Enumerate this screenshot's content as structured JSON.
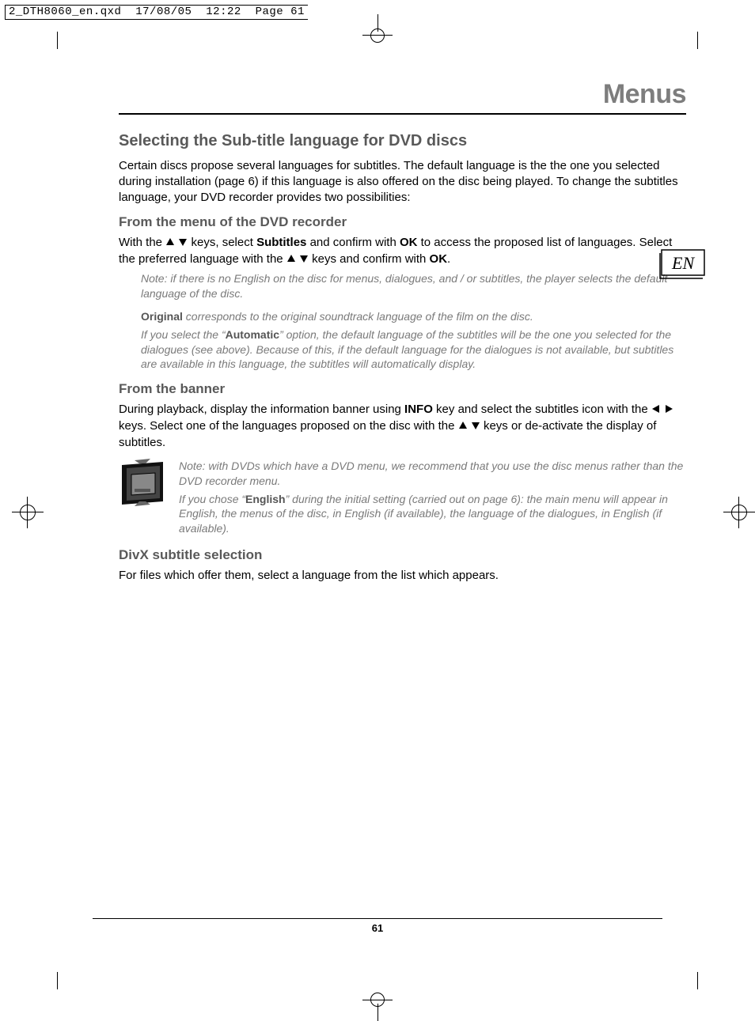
{
  "prepress": {
    "filename": "2_DTH8060_en.qxd",
    "date": "17/08/05",
    "time": "12:22",
    "page_label": "Page 61"
  },
  "chapter_title": "Menus",
  "language_badge": "EN",
  "sections": {
    "s1": {
      "title": "Selecting the Sub-title language for DVD discs",
      "p1": "Certain discs propose several languages for subtitles. The default language is the the one you selected during installation (page 6) if this language is also offered on the disc being played. To change the subtitles language, your DVD recorder provides two possibilities:"
    },
    "s2": {
      "title": "From the menu of the DVD recorder",
      "p_pre": "With the ",
      "p_mid1": " keys, select ",
      "b1": "Subtitles",
      "p_mid2": " and confirm with ",
      "b2": "OK",
      "p_mid3": " to access the proposed list of languages. Select the preferred language with the ",
      "p_mid4": " keys and confirm with ",
      "b3": "OK",
      "p_end": ".",
      "n1": "Note: if there is no English on the disc for menus, dialogues, and / or subtitles, the player selects the default language of the disc.",
      "n2_b": "Original",
      "n2": " corresponds to the original soundtrack language of the film on the disc.",
      "n3_pre": "If you select the “",
      "n3_b": "Automatic",
      "n3_post": "” option, the default language of the subtitles will be the one you selected for the dialogues (see above). Because of this, if the default language for the dialogues is not available, but subtitles are available in this language, the subtitles will automatically display."
    },
    "s3": {
      "title": "From the banner",
      "p_pre": "During playback, display the information banner using ",
      "b1": "INFO",
      "p_mid1": " key and select the subtitles icon with the ",
      "p_mid2": " keys. Select one of the languages proposed on the disc with the ",
      "p_mid3": " keys or de-activate the display of subtitles.",
      "n1": "Note: with DVDs which have a DVD menu, we recommend that you use the disc menus rather than the DVD recorder menu.",
      "n2_pre": "If you chose “",
      "n2_b": "English",
      "n2_post": "” during the initial setting (carried out on page 6): the main menu will appear in English, the menus of the disc, in English (if available), the language of the dialogues, in English (if available)."
    },
    "s4": {
      "title": "DivX subtitle selection",
      "p1": "For files which offer them, select a language from the list which appears."
    }
  },
  "page_number": "61",
  "icons": {
    "up": "up-triangle-icon",
    "down": "down-triangle-icon",
    "left": "left-triangle-icon",
    "right": "right-triangle-icon",
    "subtitle": "subtitle-screen-icon"
  }
}
